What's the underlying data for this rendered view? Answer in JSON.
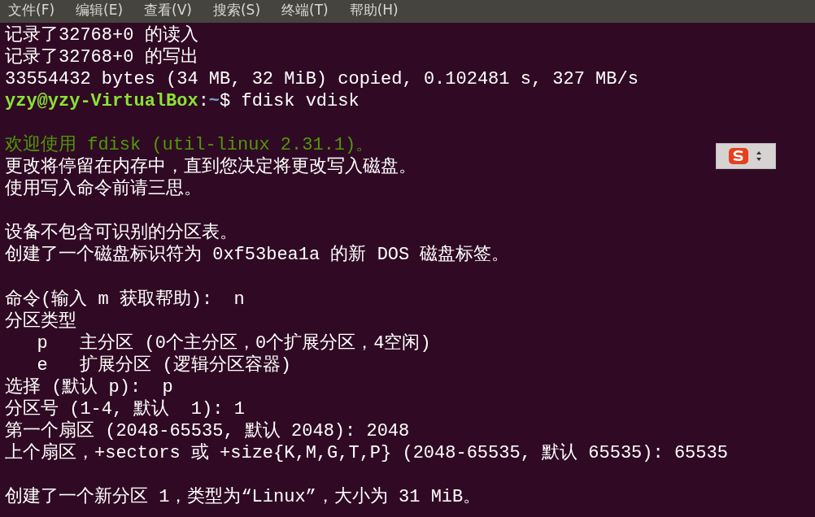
{
  "menu": [
    "文件(F)",
    "编辑(E)",
    "查看(V)",
    "搜索(S)",
    "终端(T)",
    "帮助(H)"
  ],
  "lines": [
    {
      "kind": "output",
      "text": "记录了32768+0 的读入"
    },
    {
      "kind": "output",
      "text": "记录了32768+0 的写出"
    },
    {
      "kind": "output",
      "text": "33554432 bytes (34 MB, 32 MiB) copied, 0.102481 s, 327 MB/s"
    },
    {
      "kind": "prompt",
      "user_host": "yzy@yzy-VirtualBox",
      "separator": ":",
      "path": "~",
      "symbol": "$",
      "command": "fdisk vdisk"
    },
    {
      "kind": "blank"
    },
    {
      "kind": "notice",
      "text": "欢迎使用 fdisk (util-linux 2.31.1)。"
    },
    {
      "kind": "output",
      "text": "更改将停留在内存中，直到您决定将更改写入磁盘。"
    },
    {
      "kind": "output",
      "text": "使用写入命令前请三思。"
    },
    {
      "kind": "blank"
    },
    {
      "kind": "output",
      "text": "设备不包含可识别的分区表。"
    },
    {
      "kind": "output",
      "text": "创建了一个磁盘标识符为 0xf53bea1a 的新 DOS 磁盘标签。"
    },
    {
      "kind": "blank"
    },
    {
      "kind": "output",
      "text": "命令(输入 m 获取帮助):  n"
    },
    {
      "kind": "output",
      "text": "分区类型"
    },
    {
      "kind": "output",
      "text": "   p   主分区 (0个主分区，0个扩展分区，4空闲)"
    },
    {
      "kind": "output",
      "text": "   e   扩展分区 (逻辑分区容器)"
    },
    {
      "kind": "output",
      "text": "选择 (默认 p):  p"
    },
    {
      "kind": "output",
      "text": "分区号 (1-4, 默认  1): 1"
    },
    {
      "kind": "output",
      "text": "第一个扇区 (2048-65535, 默认 2048): 2048"
    },
    {
      "kind": "output",
      "text": "上个扇区，+sectors 或 +size{K,M,G,T,P} (2048-65535, 默认 65535): 65535"
    },
    {
      "kind": "blank"
    },
    {
      "kind": "output",
      "text": "创建了一个新分区 1，类型为“Linux”，大小为 31 MiB。"
    }
  ]
}
